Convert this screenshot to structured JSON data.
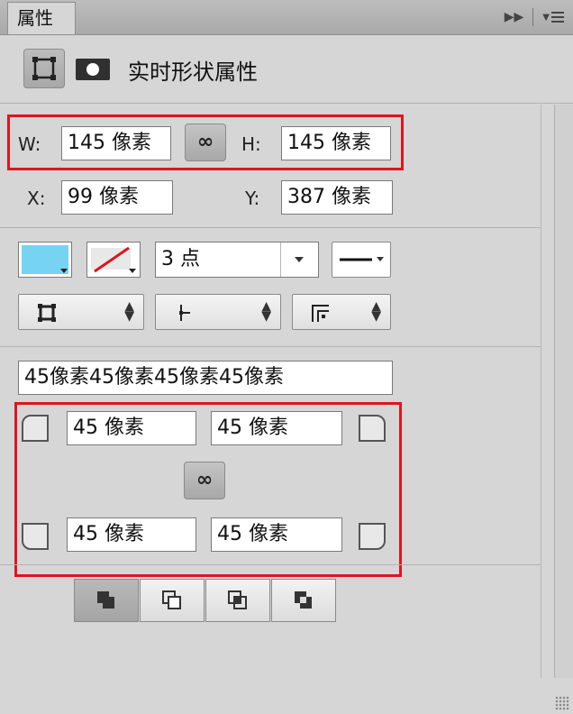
{
  "panel": {
    "tab_label": "属性",
    "header_title": "实时形状属性"
  },
  "transform": {
    "w_label": "W:",
    "w_value": "145 像素",
    "h_label": "H:",
    "h_value": "145 像素",
    "x_label": "X:",
    "x_value": "99 像素",
    "y_label": "Y:",
    "y_value": "387 像素"
  },
  "stroke": {
    "fill_color": "#77d3f2",
    "stroke_width": "3 点"
  },
  "corners": {
    "combined_value": "45像素45像素45像素45像素",
    "top_left": "45 像素",
    "top_right": "45 像素",
    "bottom_left": "45 像素",
    "bottom_right": "45 像素"
  },
  "colors": {
    "highlight": "#e0141e"
  }
}
